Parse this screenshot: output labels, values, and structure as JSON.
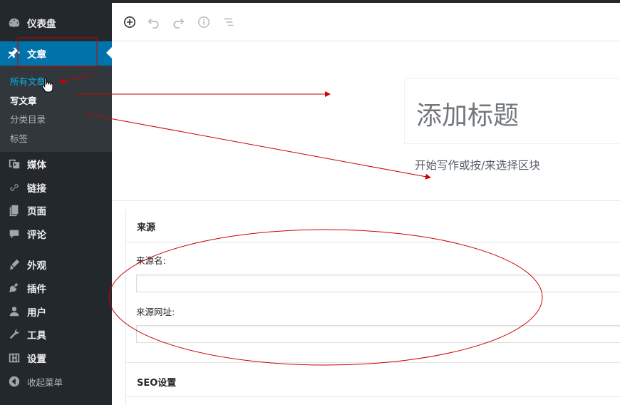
{
  "sidebar": {
    "items": [
      {
        "label": "仪表盘",
        "icon": "dashboard-icon"
      },
      {
        "label": "文章",
        "icon": "pin-icon"
      },
      {
        "label": "媒体",
        "icon": "media-icon"
      },
      {
        "label": "链接",
        "icon": "link-icon"
      },
      {
        "label": "页面",
        "icon": "page-icon"
      },
      {
        "label": "评论",
        "icon": "comment-icon"
      },
      {
        "label": "外观",
        "icon": "appearance-icon"
      },
      {
        "label": "插件",
        "icon": "plugin-icon"
      },
      {
        "label": "用户",
        "icon": "user-icon"
      },
      {
        "label": "工具",
        "icon": "wrench-icon"
      },
      {
        "label": "设置",
        "icon": "settings-icon"
      },
      {
        "label": "收起菜单",
        "icon": "collapse-icon"
      }
    ],
    "submenu": [
      {
        "label": "所有文章"
      },
      {
        "label": "写文章"
      },
      {
        "label": "分类目录"
      },
      {
        "label": "标签"
      }
    ]
  },
  "toolbar": {
    "buttons": [
      "add-block-icon",
      "undo-icon",
      "redo-icon",
      "info-icon",
      "outline-icon"
    ]
  },
  "editor": {
    "title_placeholder": "添加标题",
    "body_placeholder": "开始写作或按/来选择区块"
  },
  "metaboxes": {
    "source": {
      "title": "来源",
      "name_label": "来源名:",
      "url_label": "来源网址:",
      "name_value": "",
      "url_value": ""
    },
    "seo": {
      "title": "SEO设置"
    }
  },
  "colors": {
    "sidebar_bg": "#23282d",
    "submenu_bg": "#32373c",
    "active_bg": "#0073aa",
    "current_link": "#00b9eb",
    "annotation": "#cc0000"
  }
}
